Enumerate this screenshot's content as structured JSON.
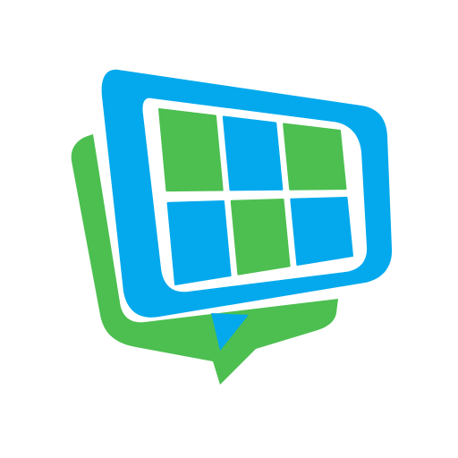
{
  "logo": {
    "icon": "solar-panel-speech-bubble-icon",
    "colors": {
      "blue": "#03A9EC",
      "green": "#4CBF50",
      "white": "#FFFFFF",
      "background": "#FFFFFF"
    },
    "panel_grid": {
      "rows": 2,
      "columns": 3,
      "cells": [
        [
          "green",
          "blue",
          "green"
        ],
        [
          "blue",
          "green",
          "blue"
        ]
      ]
    }
  }
}
